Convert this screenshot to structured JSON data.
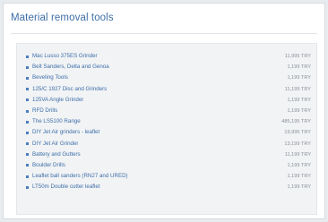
{
  "page": {
    "title": "Material removal tools"
  },
  "products": [
    {
      "name": "Mac Lusso 375ES Grinder",
      "price": "11,995 TRY"
    },
    {
      "name": "Belt Sanders, Delta and Genoa",
      "price": "1,199 TRY"
    },
    {
      "name": "Beveling Tools",
      "price": "1,199 TRY"
    },
    {
      "name": "125/C 1927 Disc and Grinders",
      "price": "11,199 TRY"
    },
    {
      "name": "125VA Angle Grinder",
      "price": "1,199 TRY"
    },
    {
      "name": "RFD Drills",
      "price": "1,199 TRY"
    },
    {
      "name": "The LS5100 Range",
      "price": "485,195 TRY"
    },
    {
      "name": "DIY Jet Air grinders - leaflet",
      "price": "19,995 TRY"
    },
    {
      "name": "DIY Jet Air Grinder",
      "price": "13,199 TRY"
    },
    {
      "name": "Battery and Gutters",
      "price": "11,199 TRY"
    },
    {
      "name": "Boulder Drills",
      "price": "1,199 TRY"
    },
    {
      "name": "Leaflet ball sanders (RN27 and URED)",
      "price": "1,199 TRY"
    },
    {
      "name": "LT50m Double cutter leaflet",
      "price": "1,199 TRY"
    }
  ],
  "colors": {
    "link": "#3f6fa8",
    "panel_background": "#f1f3f5",
    "page_background": "#ffffff"
  }
}
